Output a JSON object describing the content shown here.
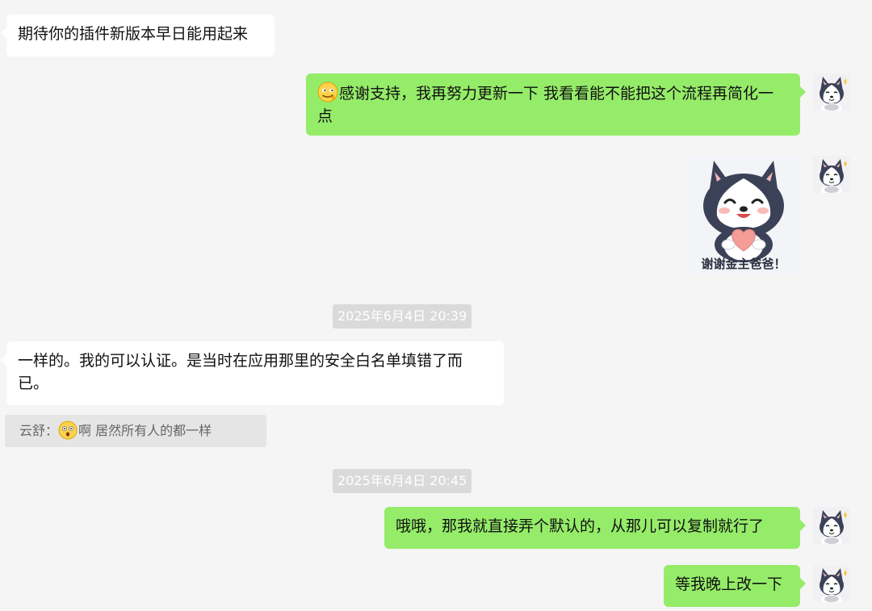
{
  "messages": [
    {
      "text": "期待你的插件新版本早日能用起来"
    },
    {
      "text": "感谢支持，我再努力更新一下 我看看能不能把这个流程再简化一点"
    },
    {
      "sticker_caption": "谢谢金主爸爸！"
    },
    {
      "text": "一样的。我的可以认证。是当时在应用那里的安全白名单填错了而已。"
    },
    {
      "text": "哦哦，那我就直接弄个默认的，从那儿可以复制就行了"
    },
    {
      "text": "等我晚上改一下"
    }
  ],
  "timestamps": [
    "2025年6月4日 20:39",
    "2025年6月4日 20:45"
  ],
  "quote": {
    "author": "云舒：",
    "text": "啊 居然所有人的都一样"
  },
  "icons": {
    "avatar": "husky-avatar-icon",
    "emoji_smile": "smirk-emoji-icon",
    "emoji_surprised": "surprised-emoji-icon"
  },
  "colors": {
    "background": "#f5f5f5",
    "incoming_bubble": "#ffffff",
    "outgoing_bubble": "#95ec69",
    "timestamp_bg": "#dadada",
    "quote_bg": "#e5e5e5"
  }
}
